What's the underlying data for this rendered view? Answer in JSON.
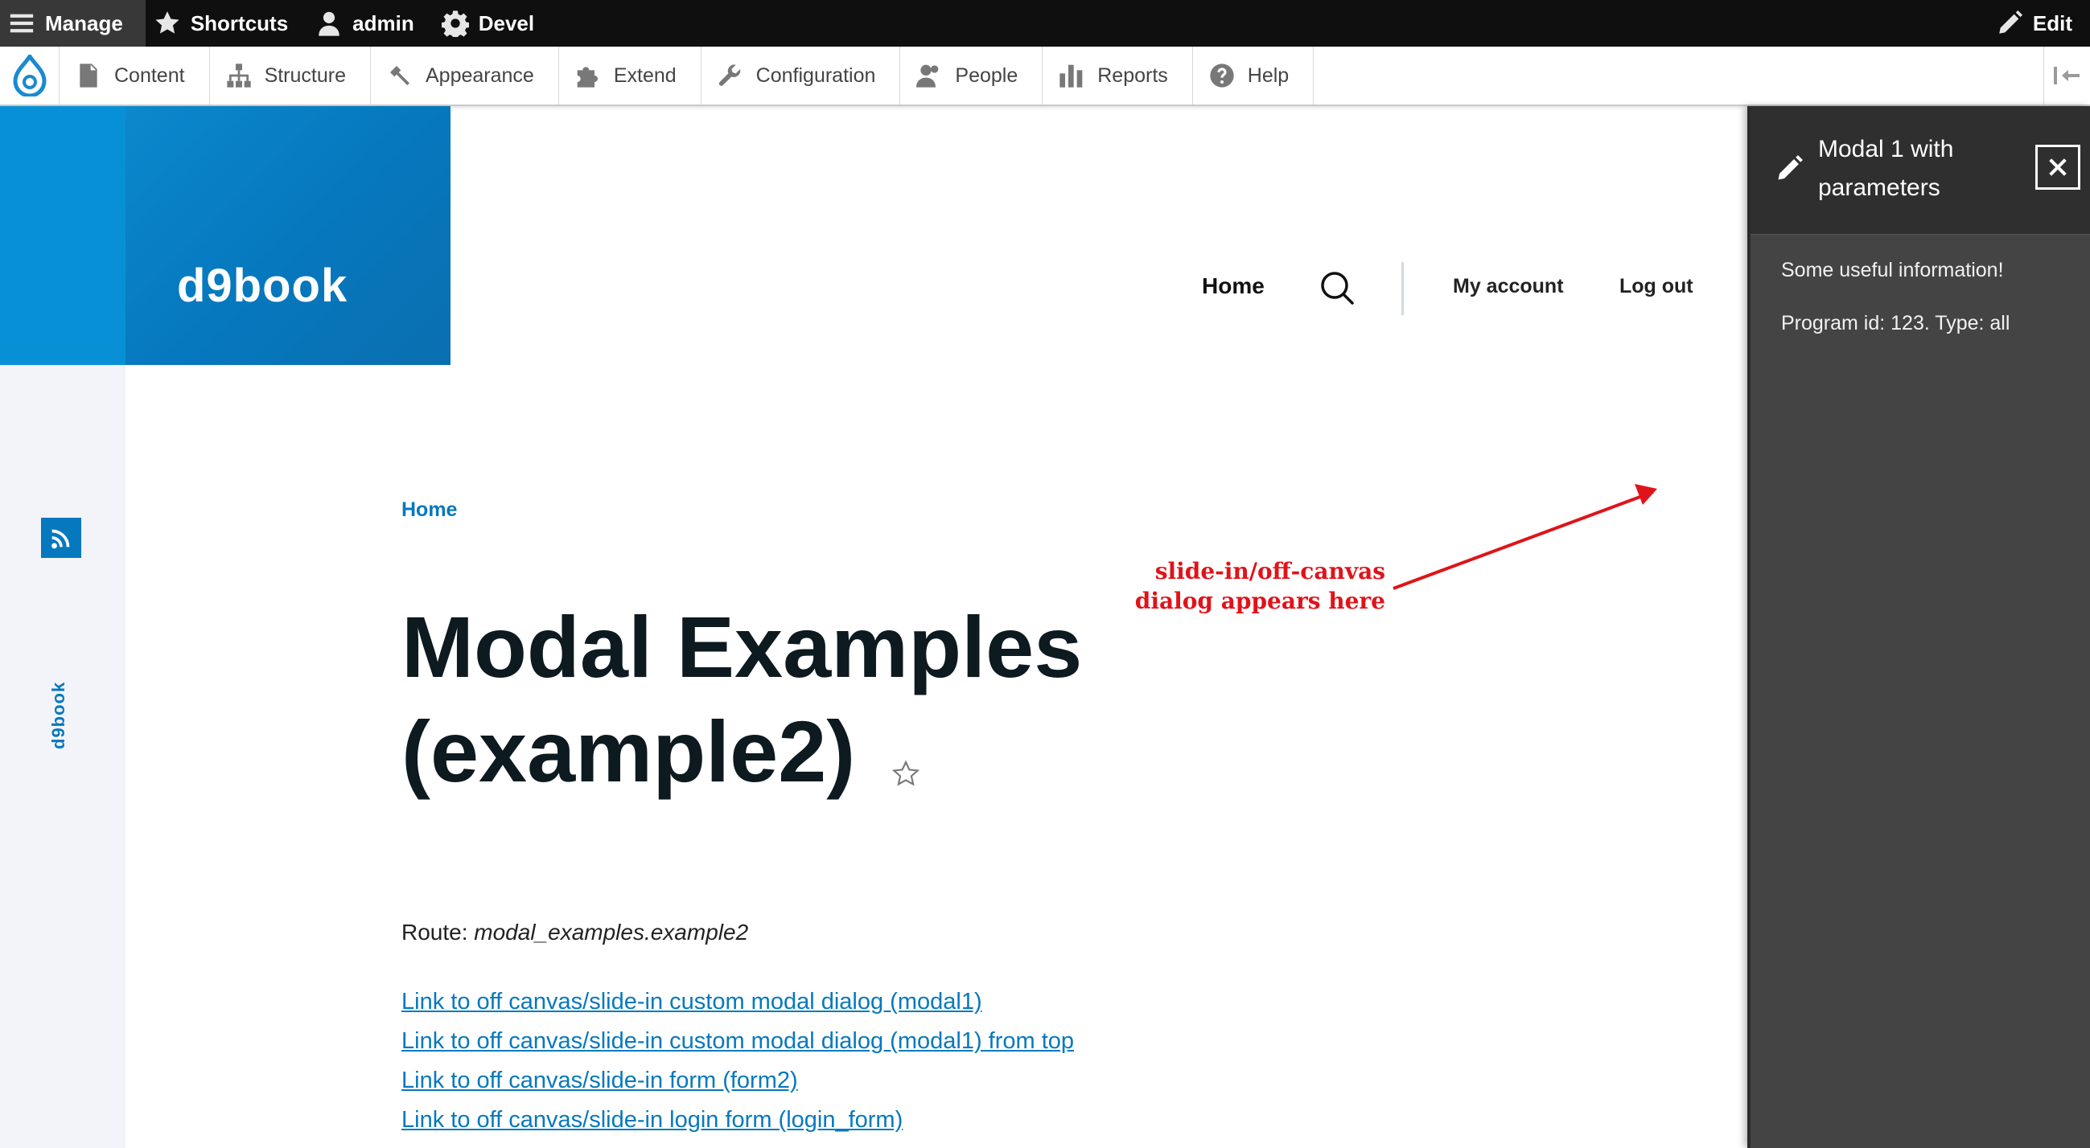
{
  "toolbar": {
    "manage": "Manage",
    "shortcuts": "Shortcuts",
    "user": "admin",
    "devel": "Devel",
    "edit": "Edit"
  },
  "tray": {
    "items": [
      "Content",
      "Structure",
      "Appearance",
      "Extend",
      "Configuration",
      "People",
      "Reports",
      "Help"
    ]
  },
  "site": {
    "name": "d9book",
    "rail_label": "d9book"
  },
  "nav": {
    "home": "Home",
    "my_account": "My account",
    "log_out": "Log out"
  },
  "main": {
    "breadcrumb": "Home",
    "title_line1": "Modal Examples",
    "title_line2": "(example2)",
    "route_label": "Route: ",
    "route_value": "modal_examples.example2",
    "links": [
      "Link to off canvas/slide-in custom modal dialog (modal1)",
      "Link to off canvas/slide-in custom modal dialog (modal1) from top",
      "Link to off canvas/slide-in form (form2)",
      "Link to off canvas/slide-in login form (login_form)"
    ]
  },
  "annotation": {
    "line1": "slide-in/off-canvas",
    "line2": "dialog appears here",
    "color": "#e0131a"
  },
  "dialog": {
    "title": "Modal 1 with parameters",
    "info": "Some useful information!",
    "program": "Program id: 123. Type: all"
  },
  "colors": {
    "brand_blue": "#0678be",
    "toolbar_bg": "#0f0f0f",
    "dialog_bg": "#444444"
  }
}
